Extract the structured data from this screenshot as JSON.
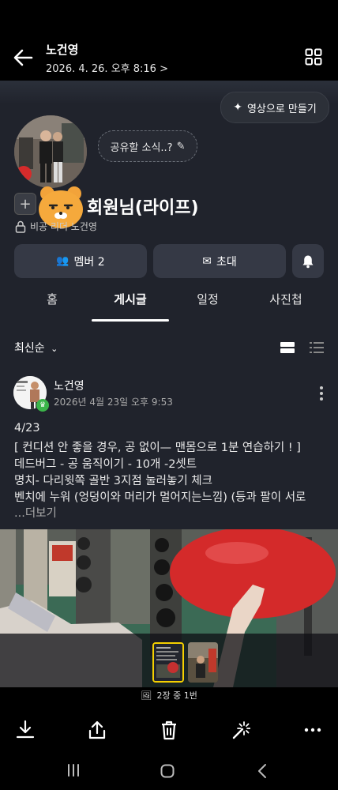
{
  "header": {
    "title": "노건영",
    "date": "2026. 4. 26. 오후 8:16 >"
  },
  "cover": {
    "video_button": "영상으로 만들기",
    "bubble_text": "공유할 소식..?",
    "group_name": "회원님(라이프)",
    "sub_info": "비공  리더 노건영"
  },
  "actions": {
    "member": "멤버 2",
    "invite": "초대"
  },
  "tabs": [
    "홈",
    "게시글",
    "일정",
    "사진첩"
  ],
  "active_tab": "게시글",
  "sort": "최신순",
  "post": {
    "author": "노건영",
    "date": "2026년 4월 23일 오후 9:53",
    "lines": [
      "4/23",
      "[ 컨디션 안 좋을 경우, 공 없이— 맨몸으로 1분 연습하기 ! ]",
      "데드버그 - 공 움직이기 - 10개 -2셋트",
      "명치- 다리윗쪽 골반 3지점 눌러놓기 체크",
      "벤치에 누워 (엉덩이와 머리가 멀어지는느낌) (등과 팔이 서로"
    ],
    "more": "...더보기"
  },
  "gallery": {
    "counter": "2장 중 1번"
  },
  "colors": {
    "background": "#000000",
    "panel": "#20232c",
    "button": "#353945",
    "accent_yellow": "#f5d000"
  },
  "icons": [
    "back-arrow-icon",
    "grid-icon",
    "sparkle-icon",
    "pencil-icon",
    "people-icon",
    "mail-icon",
    "bell-icon",
    "lock-icon",
    "download-icon",
    "share-icon",
    "trash-icon",
    "magic-wand-icon",
    "more-icon"
  ]
}
